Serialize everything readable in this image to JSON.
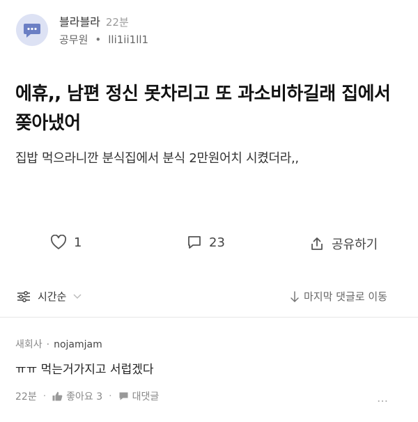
{
  "post": {
    "author": "블라블라",
    "time": "22분",
    "company": "공무원",
    "handle": "lli1ii1ll1",
    "title": "에휴,, 남편 정신 못차리고 또 과소비하길래 집에서 쫒아냈어",
    "body": "집밥 먹으라니깐 분식집에서 분식 2만원어치 시켰더라,,"
  },
  "actions": {
    "like_count": "1",
    "comment_count": "23",
    "share_label": "공유하기"
  },
  "sort": {
    "label": "시간순",
    "jump_label": "마지막 댓글로 이동"
  },
  "comment": {
    "company": "새회사",
    "author": "nojamjam",
    "text": "ㅠㅠ 먹는거가지고 서럽겠다",
    "time": "22분",
    "like_label": "좋아요 3",
    "reply_label": "대댓글",
    "more": "…"
  },
  "icons": [
    "chat-bubble-icon",
    "heart-icon",
    "comment-icon",
    "share-icon",
    "sort-icon",
    "chevron-down-icon",
    "arrow-down-icon",
    "thumbs-up-icon",
    "reply-icon",
    "more-icon"
  ],
  "colors": {
    "avatar_bg": "#dde2f4",
    "avatar_icon": "#6b7fc4"
  }
}
